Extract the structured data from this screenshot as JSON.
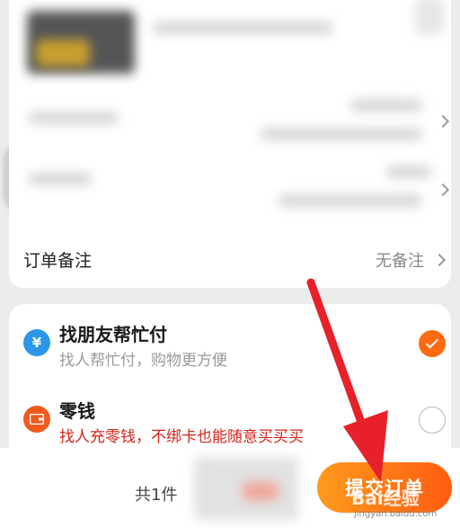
{
  "order_card": {
    "remark_label": "订单备注",
    "remark_value": "无备注"
  },
  "payment": {
    "options": [
      {
        "icon": "friend-pay-icon",
        "title": "找朋友帮忙付",
        "subtitle": "找人帮忙付，购物更方便",
        "selected": true
      },
      {
        "icon": "wallet-icon",
        "title": "零钱",
        "subtitle": "找人充零钱，不绑卡也能随意买买买",
        "selected": false
      }
    ]
  },
  "bottom_bar": {
    "count_text": "共1件",
    "submit_label": "提交订单"
  },
  "watermark": {
    "brand": "Bai",
    "brand_suffix": "经验",
    "url": "jingyan.baidu.com"
  },
  "colors": {
    "accent": "#ff6a13",
    "warning_text": "#d8231b",
    "annotation_arrow": "#e8202a"
  }
}
